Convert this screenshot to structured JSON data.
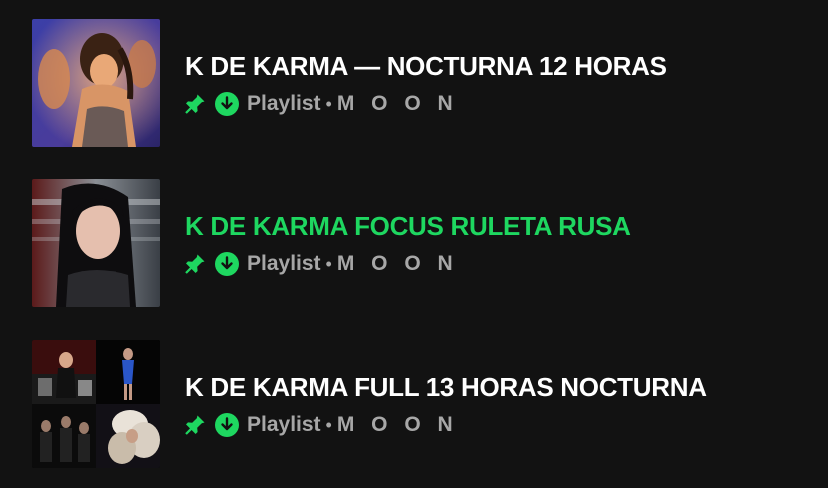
{
  "playlists": [
    {
      "title": "K DE KARMA — NOCTURNA 12 HORAS",
      "active": false,
      "type": "Playlist",
      "separator": "•",
      "owner": "M O O N",
      "pinned_icon": "pin-icon",
      "downloaded_icon": "download-icon"
    },
    {
      "title": "K DE KARMA FOCUS RULETA RUSA",
      "active": true,
      "type": "Playlist",
      "separator": "•",
      "owner": "M O O N",
      "pinned_icon": "pin-icon",
      "downloaded_icon": "download-icon"
    },
    {
      "title": "K DE KARMA FULL 13 HORAS NOCTURNA",
      "active": false,
      "type": "Playlist",
      "separator": "•",
      "owner": "M O O N",
      "pinned_icon": "pin-icon",
      "downloaded_icon": "download-icon"
    }
  ],
  "colors": {
    "background": "#121212",
    "accent": "#1ed760",
    "title": "#ffffff",
    "subtitle": "#a7a7a7"
  }
}
